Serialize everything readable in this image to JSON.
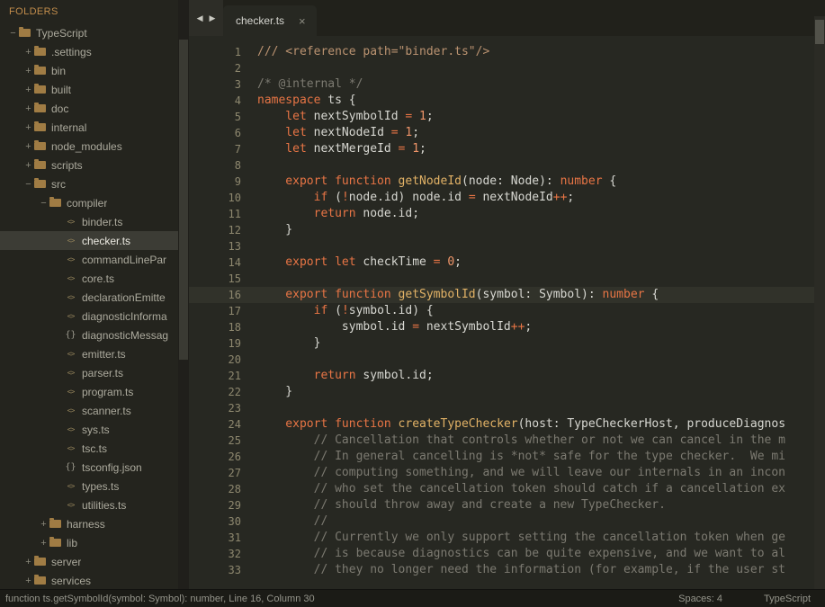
{
  "theme": {
    "bg": "#272822",
    "sidebarBg": "#24241e",
    "tabbarBg": "#21211b",
    "statusBg": "#1b1b16",
    "text": "#d8d8d2",
    "kw": "#e87545",
    "num": "#ef9569",
    "fn": "#e2b266",
    "cm": "#7c7a71",
    "doc": "#bb9371",
    "ln": "#8e886f",
    "hdr": "#c28d4c",
    "treeText": "#acaa9d",
    "selBg": "#3c3c35",
    "selText": "#eceae2",
    "folder": "#a07c44"
  },
  "sidebar": {
    "header": "FOLDERS",
    "tree": [
      {
        "label": "TypeScript",
        "kind": "folder",
        "expand": "−",
        "indent": 0
      },
      {
        "label": ".settings",
        "kind": "folder",
        "expand": "+",
        "indent": 1
      },
      {
        "label": "bin",
        "kind": "folder",
        "expand": "+",
        "indent": 1
      },
      {
        "label": "built",
        "kind": "folder",
        "expand": "+",
        "indent": 1
      },
      {
        "label": "doc",
        "kind": "folder",
        "expand": "+",
        "indent": 1
      },
      {
        "label": "internal",
        "kind": "folder",
        "expand": "+",
        "indent": 1
      },
      {
        "label": "node_modules",
        "kind": "folder",
        "expand": "+",
        "indent": 1
      },
      {
        "label": "scripts",
        "kind": "folder",
        "expand": "+",
        "indent": 1
      },
      {
        "label": "src",
        "kind": "folder",
        "expand": "−",
        "indent": 1
      },
      {
        "label": "compiler",
        "kind": "folder",
        "expand": "−",
        "indent": 2
      },
      {
        "label": "binder.ts",
        "kind": "file-ts",
        "expand": null,
        "indent": 3
      },
      {
        "label": "checker.ts",
        "kind": "file-ts",
        "expand": null,
        "indent": 3,
        "selected": true
      },
      {
        "label": "commandLinePar",
        "kind": "file-ts",
        "expand": null,
        "indent": 3
      },
      {
        "label": "core.ts",
        "kind": "file-ts",
        "expand": null,
        "indent": 3
      },
      {
        "label": "declarationEmitte",
        "kind": "file-ts",
        "expand": null,
        "indent": 3
      },
      {
        "label": "diagnosticInforma",
        "kind": "file-ts",
        "expand": null,
        "indent": 3
      },
      {
        "label": "diagnosticMessag",
        "kind": "file-json",
        "expand": null,
        "indent": 3
      },
      {
        "label": "emitter.ts",
        "kind": "file-ts",
        "expand": null,
        "indent": 3
      },
      {
        "label": "parser.ts",
        "kind": "file-ts",
        "expand": null,
        "indent": 3
      },
      {
        "label": "program.ts",
        "kind": "file-ts",
        "expand": null,
        "indent": 3
      },
      {
        "label": "scanner.ts",
        "kind": "file-ts",
        "expand": null,
        "indent": 3
      },
      {
        "label": "sys.ts",
        "kind": "file-ts",
        "expand": null,
        "indent": 3
      },
      {
        "label": "tsc.ts",
        "kind": "file-ts",
        "expand": null,
        "indent": 3
      },
      {
        "label": "tsconfig.json",
        "kind": "file-json",
        "expand": null,
        "indent": 3
      },
      {
        "label": "types.ts",
        "kind": "file-ts",
        "expand": null,
        "indent": 3
      },
      {
        "label": "utilities.ts",
        "kind": "file-ts",
        "expand": null,
        "indent": 3
      },
      {
        "label": "harness",
        "kind": "folder",
        "expand": "+",
        "indent": 2
      },
      {
        "label": "lib",
        "kind": "folder",
        "expand": "+",
        "indent": 2
      },
      {
        "label": "server",
        "kind": "folder",
        "expand": "+",
        "indent": 1
      },
      {
        "label": "services",
        "kind": "folder",
        "expand": "+",
        "indent": 1
      }
    ],
    "icons": {
      "ts_file": "<>",
      "json_file": "{}"
    }
  },
  "tabbar": {
    "back_icon": "◀",
    "forward_icon": "▶",
    "tab": {
      "label": "checker.ts",
      "close": "×"
    }
  },
  "editor": {
    "lines": [
      {
        "n": 1,
        "t": [
          [
            "doc",
            "/// <reference path=\"binder.ts\"/>"
          ]
        ]
      },
      {
        "n": 2,
        "t": []
      },
      {
        "n": 3,
        "t": [
          [
            "cm",
            "/* @internal */"
          ]
        ]
      },
      {
        "n": 4,
        "t": [
          [
            "k",
            "namespace"
          ],
          [
            "id",
            " ts {"
          ]
        ]
      },
      {
        "n": 5,
        "t": [
          [
            "k",
            "    let"
          ],
          [
            "id",
            " nextSymbolId "
          ],
          [
            "op",
            "="
          ],
          [
            "num",
            " 1"
          ],
          [
            "id",
            ";"
          ]
        ]
      },
      {
        "n": 6,
        "t": [
          [
            "k",
            "    let"
          ],
          [
            "id",
            " nextNodeId "
          ],
          [
            "op",
            "="
          ],
          [
            "num",
            " 1"
          ],
          [
            "id",
            ";"
          ]
        ]
      },
      {
        "n": 7,
        "t": [
          [
            "k",
            "    let"
          ],
          [
            "id",
            " nextMergeId "
          ],
          [
            "op",
            "="
          ],
          [
            "num",
            " 1"
          ],
          [
            "id",
            ";"
          ]
        ]
      },
      {
        "n": 8,
        "t": []
      },
      {
        "n": 9,
        "t": [
          [
            "k",
            "    export function"
          ],
          [
            "fn",
            " getNodeId"
          ],
          [
            "id",
            "(node: Node): "
          ],
          [
            "k",
            "number"
          ],
          [
            "id",
            " {"
          ]
        ]
      },
      {
        "n": 10,
        "t": [
          [
            "k",
            "        if"
          ],
          [
            "id",
            " ("
          ],
          [
            "op",
            "!"
          ],
          [
            "id",
            "node.id) node.id "
          ],
          [
            "op",
            "="
          ],
          [
            "id",
            " nextNodeId"
          ],
          [
            "op",
            "++"
          ],
          [
            "id",
            ";"
          ]
        ]
      },
      {
        "n": 11,
        "t": [
          [
            "k",
            "        return"
          ],
          [
            "id",
            " node.id;"
          ]
        ]
      },
      {
        "n": 12,
        "t": [
          [
            "id",
            "    }"
          ]
        ]
      },
      {
        "n": 13,
        "t": []
      },
      {
        "n": 14,
        "t": [
          [
            "k",
            "    export let"
          ],
          [
            "id",
            " checkTime "
          ],
          [
            "op",
            "="
          ],
          [
            "num",
            " 0"
          ],
          [
            "id",
            ";"
          ]
        ]
      },
      {
        "n": 15,
        "t": []
      },
      {
        "n": 16,
        "hl": true,
        "t": [
          [
            "k",
            "    export function"
          ],
          [
            "fn",
            " getSymbolId"
          ],
          [
            "id",
            "(symbol: Symbol): "
          ],
          [
            "k",
            "number"
          ],
          [
            "id",
            " {"
          ]
        ]
      },
      {
        "n": 17,
        "t": [
          [
            "k",
            "        if"
          ],
          [
            "id",
            " ("
          ],
          [
            "op",
            "!"
          ],
          [
            "id",
            "symbol.id) {"
          ]
        ]
      },
      {
        "n": 18,
        "t": [
          [
            "id",
            "            symbol.id "
          ],
          [
            "op",
            "="
          ],
          [
            "id",
            " nextSymbolId"
          ],
          [
            "op",
            "++"
          ],
          [
            "id",
            ";"
          ]
        ]
      },
      {
        "n": 19,
        "t": [
          [
            "id",
            "        }"
          ]
        ]
      },
      {
        "n": 20,
        "t": []
      },
      {
        "n": 21,
        "t": [
          [
            "k",
            "        return"
          ],
          [
            "id",
            " symbol.id;"
          ]
        ]
      },
      {
        "n": 22,
        "t": [
          [
            "id",
            "    }"
          ]
        ]
      },
      {
        "n": 23,
        "t": []
      },
      {
        "n": 24,
        "t": [
          [
            "k",
            "    export function"
          ],
          [
            "fn",
            " createTypeChecker"
          ],
          [
            "id",
            "(host: TypeCheckerHost, produceDiagnos"
          ]
        ]
      },
      {
        "n": 25,
        "t": [
          [
            "cm",
            "        // Cancellation that controls whether or not we can cancel in the m"
          ]
        ]
      },
      {
        "n": 26,
        "t": [
          [
            "cm",
            "        // In general cancelling is *not* safe for the type checker.  We mi"
          ]
        ]
      },
      {
        "n": 27,
        "t": [
          [
            "cm",
            "        // computing something, and we will leave our internals in an incon"
          ]
        ]
      },
      {
        "n": 28,
        "t": [
          [
            "cm",
            "        // who set the cancellation token should catch if a cancellation ex"
          ]
        ]
      },
      {
        "n": 29,
        "t": [
          [
            "cm",
            "        // should throw away and create a new TypeChecker."
          ]
        ]
      },
      {
        "n": 30,
        "t": [
          [
            "cm",
            "        //"
          ]
        ]
      },
      {
        "n": 31,
        "t": [
          [
            "cm",
            "        // Currently we only support setting the cancellation token when ge"
          ]
        ]
      },
      {
        "n": 32,
        "t": [
          [
            "cm",
            "        // is because diagnostics can be quite expensive, and we want to al"
          ]
        ]
      },
      {
        "n": 33,
        "t": [
          [
            "cm",
            "        // they no longer need the information (for example, if the user st"
          ]
        ]
      }
    ]
  },
  "statusbar": {
    "context": "function ts.getSymbolId(symbol: Symbol): number, Line 16, Column 30",
    "spaces": "Spaces: 4",
    "language": "TypeScript"
  }
}
